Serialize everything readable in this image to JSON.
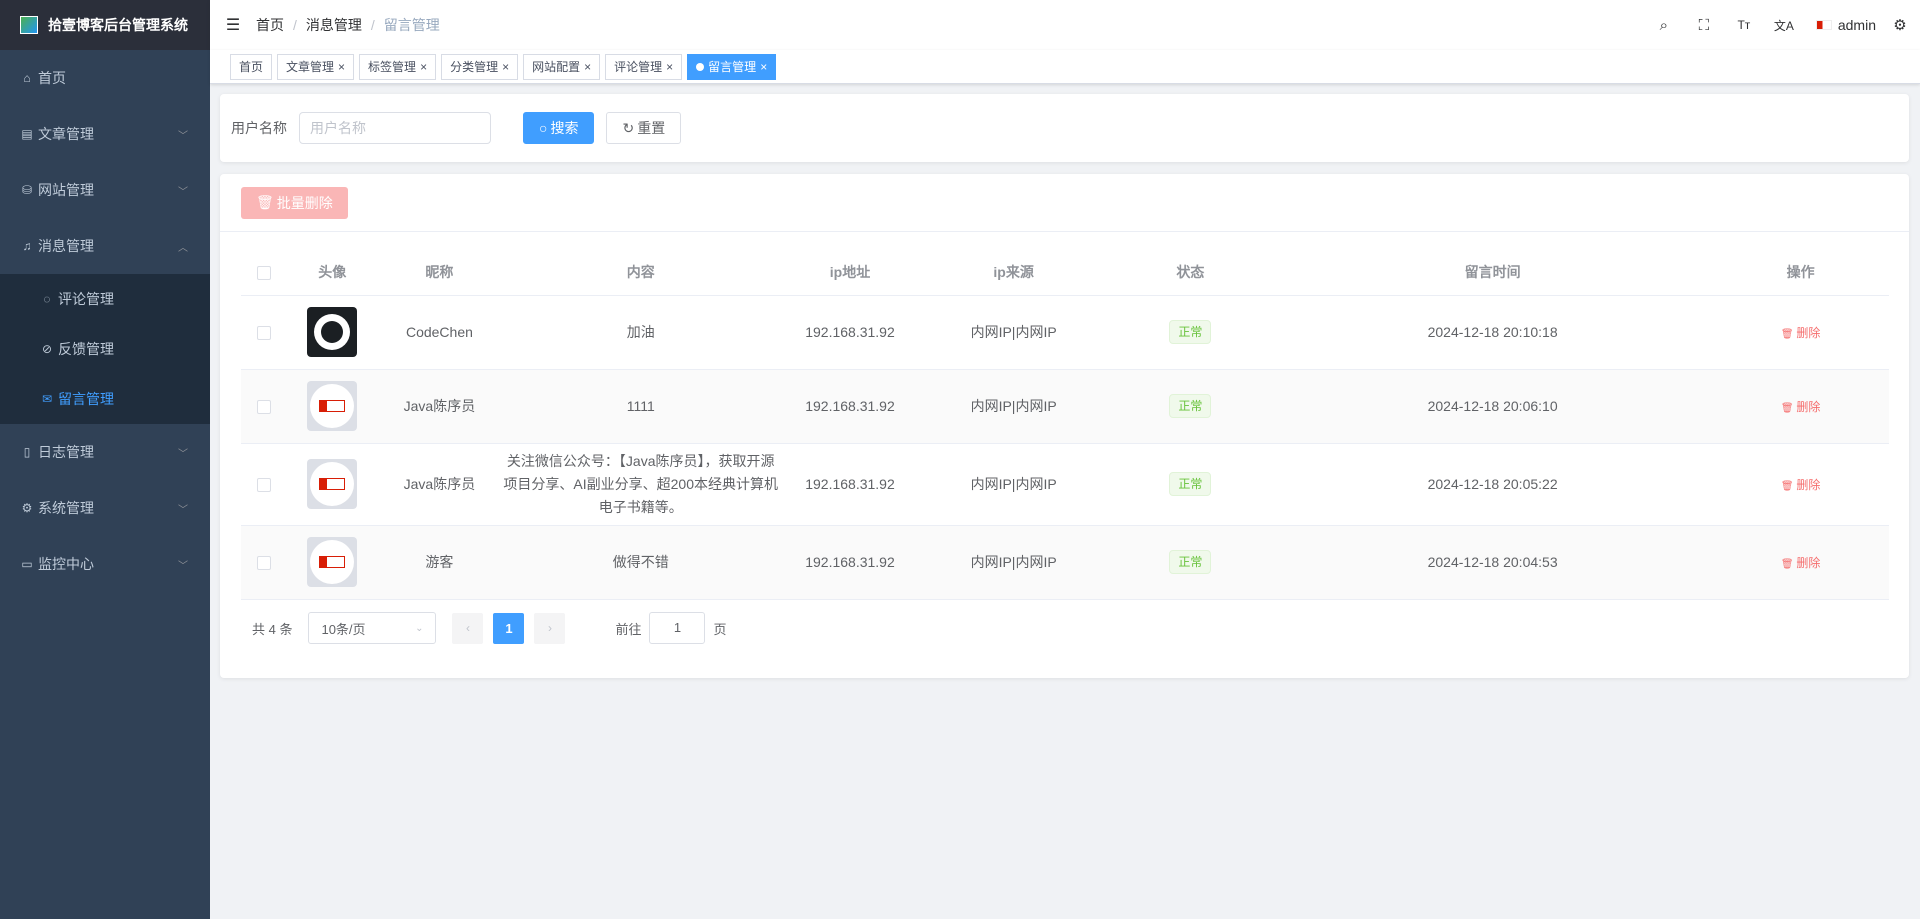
{
  "app": {
    "title": "拾壹博客后台管理系统"
  },
  "sidebar": {
    "items": [
      {
        "label": "首页",
        "icon": "home-icon",
        "glyph": "⌂",
        "expandable": false
      },
      {
        "label": "文章管理",
        "icon": "document-icon",
        "glyph": "▤",
        "expandable": true,
        "expanded": false
      },
      {
        "label": "网站管理",
        "icon": "website-icon",
        "glyph": "⛁",
        "expandable": true,
        "expanded": false
      },
      {
        "label": "消息管理",
        "icon": "bell-icon",
        "glyph": "♫",
        "expandable": true,
        "expanded": true,
        "children": [
          {
            "label": "评论管理",
            "icon": "comment-icon",
            "glyph": "◌"
          },
          {
            "label": "反馈管理",
            "icon": "feedback-icon",
            "glyph": "⊘"
          },
          {
            "label": "留言管理",
            "icon": "message-icon",
            "glyph": "✉",
            "active": true
          }
        ]
      },
      {
        "label": "日志管理",
        "icon": "log-icon",
        "glyph": "▯",
        "expandable": true,
        "expanded": false
      },
      {
        "label": "系统管理",
        "icon": "settings-icon",
        "glyph": "⚙",
        "expandable": true,
        "expanded": false
      },
      {
        "label": "监控中心",
        "icon": "monitor-icon",
        "glyph": "▭",
        "expandable": true,
        "expanded": false
      }
    ]
  },
  "navbar": {
    "breadcrumb": [
      "首页",
      "消息管理",
      "留言管理"
    ],
    "user": "admin"
  },
  "tags": [
    {
      "label": "首页",
      "closable": false,
      "active": false
    },
    {
      "label": "文章管理",
      "closable": true,
      "active": false
    },
    {
      "label": "标签管理",
      "closable": true,
      "active": false
    },
    {
      "label": "分类管理",
      "closable": true,
      "active": false
    },
    {
      "label": "网站配置",
      "closable": true,
      "active": false
    },
    {
      "label": "评论管理",
      "closable": true,
      "active": false
    },
    {
      "label": "留言管理",
      "closable": true,
      "active": true
    }
  ],
  "search": {
    "label": "用户名称",
    "placeholder": "用户名称",
    "search_label": "搜索",
    "reset_label": "重置"
  },
  "toolbar": {
    "batch_delete_label": "批量删除"
  },
  "table": {
    "headers": [
      "头像",
      "昵称",
      "内容",
      "ip地址",
      "ip来源",
      "状态",
      "留言时间",
      "操作"
    ],
    "rows": [
      {
        "avatar": "github",
        "nickname": "CodeChen",
        "content": "加油",
        "ip": "192.168.31.92",
        "ip_source": "内网IP|内网IP",
        "status": "正常",
        "time": "2024-12-18 20:10:18",
        "action": "删除"
      },
      {
        "avatar": "java",
        "nickname": "Java陈序员",
        "content": "1111",
        "ip": "192.168.31.92",
        "ip_source": "内网IP|内网IP",
        "status": "正常",
        "time": "2024-12-18 20:06:10",
        "action": "删除"
      },
      {
        "avatar": "java",
        "nickname": "Java陈序员",
        "content": "关注微信公众号：【Java陈序员】，获取开源项目分享、AI副业分享、超200本经典计算机电子书籍等。",
        "ip": "192.168.31.92",
        "ip_source": "内网IP|内网IP",
        "status": "正常",
        "time": "2024-12-18 20:05:22",
        "action": "删除"
      },
      {
        "avatar": "java",
        "nickname": "游客",
        "content": "做得不错",
        "ip": "192.168.31.92",
        "ip_source": "内网IP|内网IP",
        "status": "正常",
        "time": "2024-12-18 20:04:53",
        "action": "删除"
      }
    ]
  },
  "pagination": {
    "total_text": "共 4 条",
    "page_size": "10条/页",
    "current_page": "1",
    "goto_prefix": "前往",
    "goto_value": "1",
    "goto_suffix": "页"
  },
  "colors": {
    "sidebar_bg": "#304156",
    "primary": "#409eff",
    "danger": "#f56c6c",
    "success": "#67c23a"
  }
}
